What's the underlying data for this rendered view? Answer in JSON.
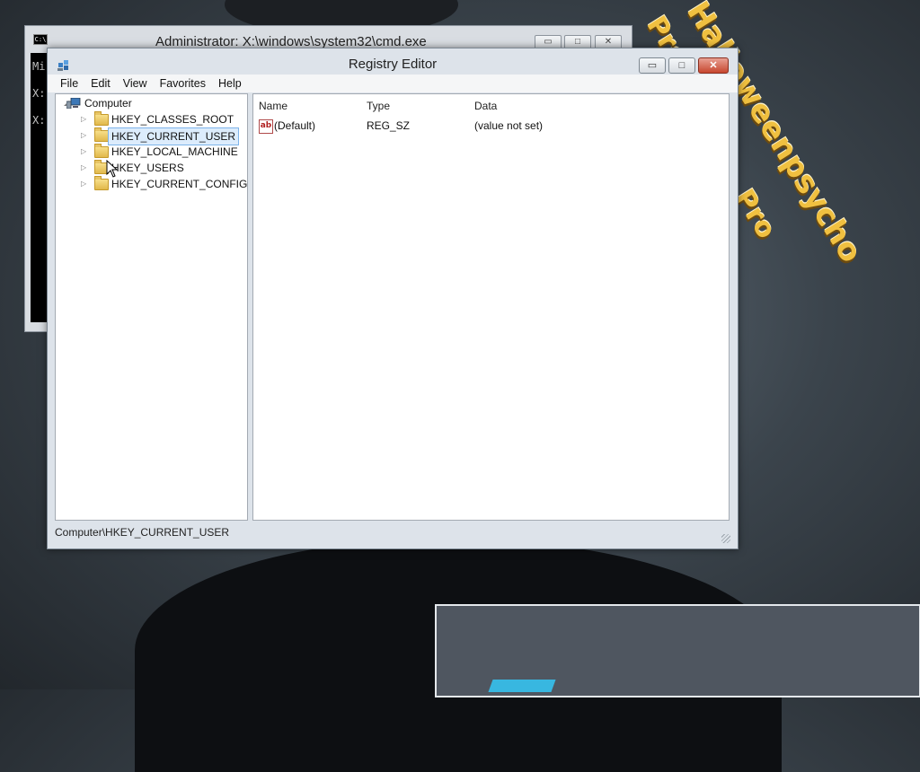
{
  "wallpaper": {
    "overlay_lines": [
      "Halloweenpsycho",
      "Presents",
      "Pro"
    ]
  },
  "cmd_window": {
    "title": "Administrator: X:\\windows\\system32\\cmd.exe",
    "icon_text": "C:\\",
    "console_lines": [
      "Mi",
      "X:",
      "X:"
    ],
    "buttons": {
      "minimize": "▭",
      "maximize": "□",
      "close": "✕"
    }
  },
  "registry_window": {
    "title": "Registry Editor",
    "buttons": {
      "minimize": "▭",
      "maximize": "□",
      "close": "✕"
    },
    "menu": [
      "File",
      "Edit",
      "View",
      "Favorites",
      "Help"
    ],
    "tree": {
      "root": "Computer",
      "root_arrow": "◢",
      "child_arrow": "▷",
      "items": [
        {
          "label": "HKEY_CLASSES_ROOT",
          "selected": false
        },
        {
          "label": "HKEY_CURRENT_USER",
          "selected": true
        },
        {
          "label": "HKEY_LOCAL_MACHINE",
          "selected": false
        },
        {
          "label": "HKEY_USERS",
          "selected": false
        },
        {
          "label": "HKEY_CURRENT_CONFIG",
          "selected": false
        }
      ]
    },
    "columns": {
      "name": "Name",
      "type": "Type",
      "data": "Data"
    },
    "values": [
      {
        "icon": "ab",
        "name": "(Default)",
        "type": "REG_SZ",
        "data": "(value not set)"
      }
    ],
    "status_bar": "Computer\\HKEY_CURRENT_USER"
  },
  "colors": {
    "selection_bg": "#dcecfc",
    "selection_border": "#7eb4ea",
    "overlay_text": "#f0c040",
    "close_button": "#c7472f"
  }
}
